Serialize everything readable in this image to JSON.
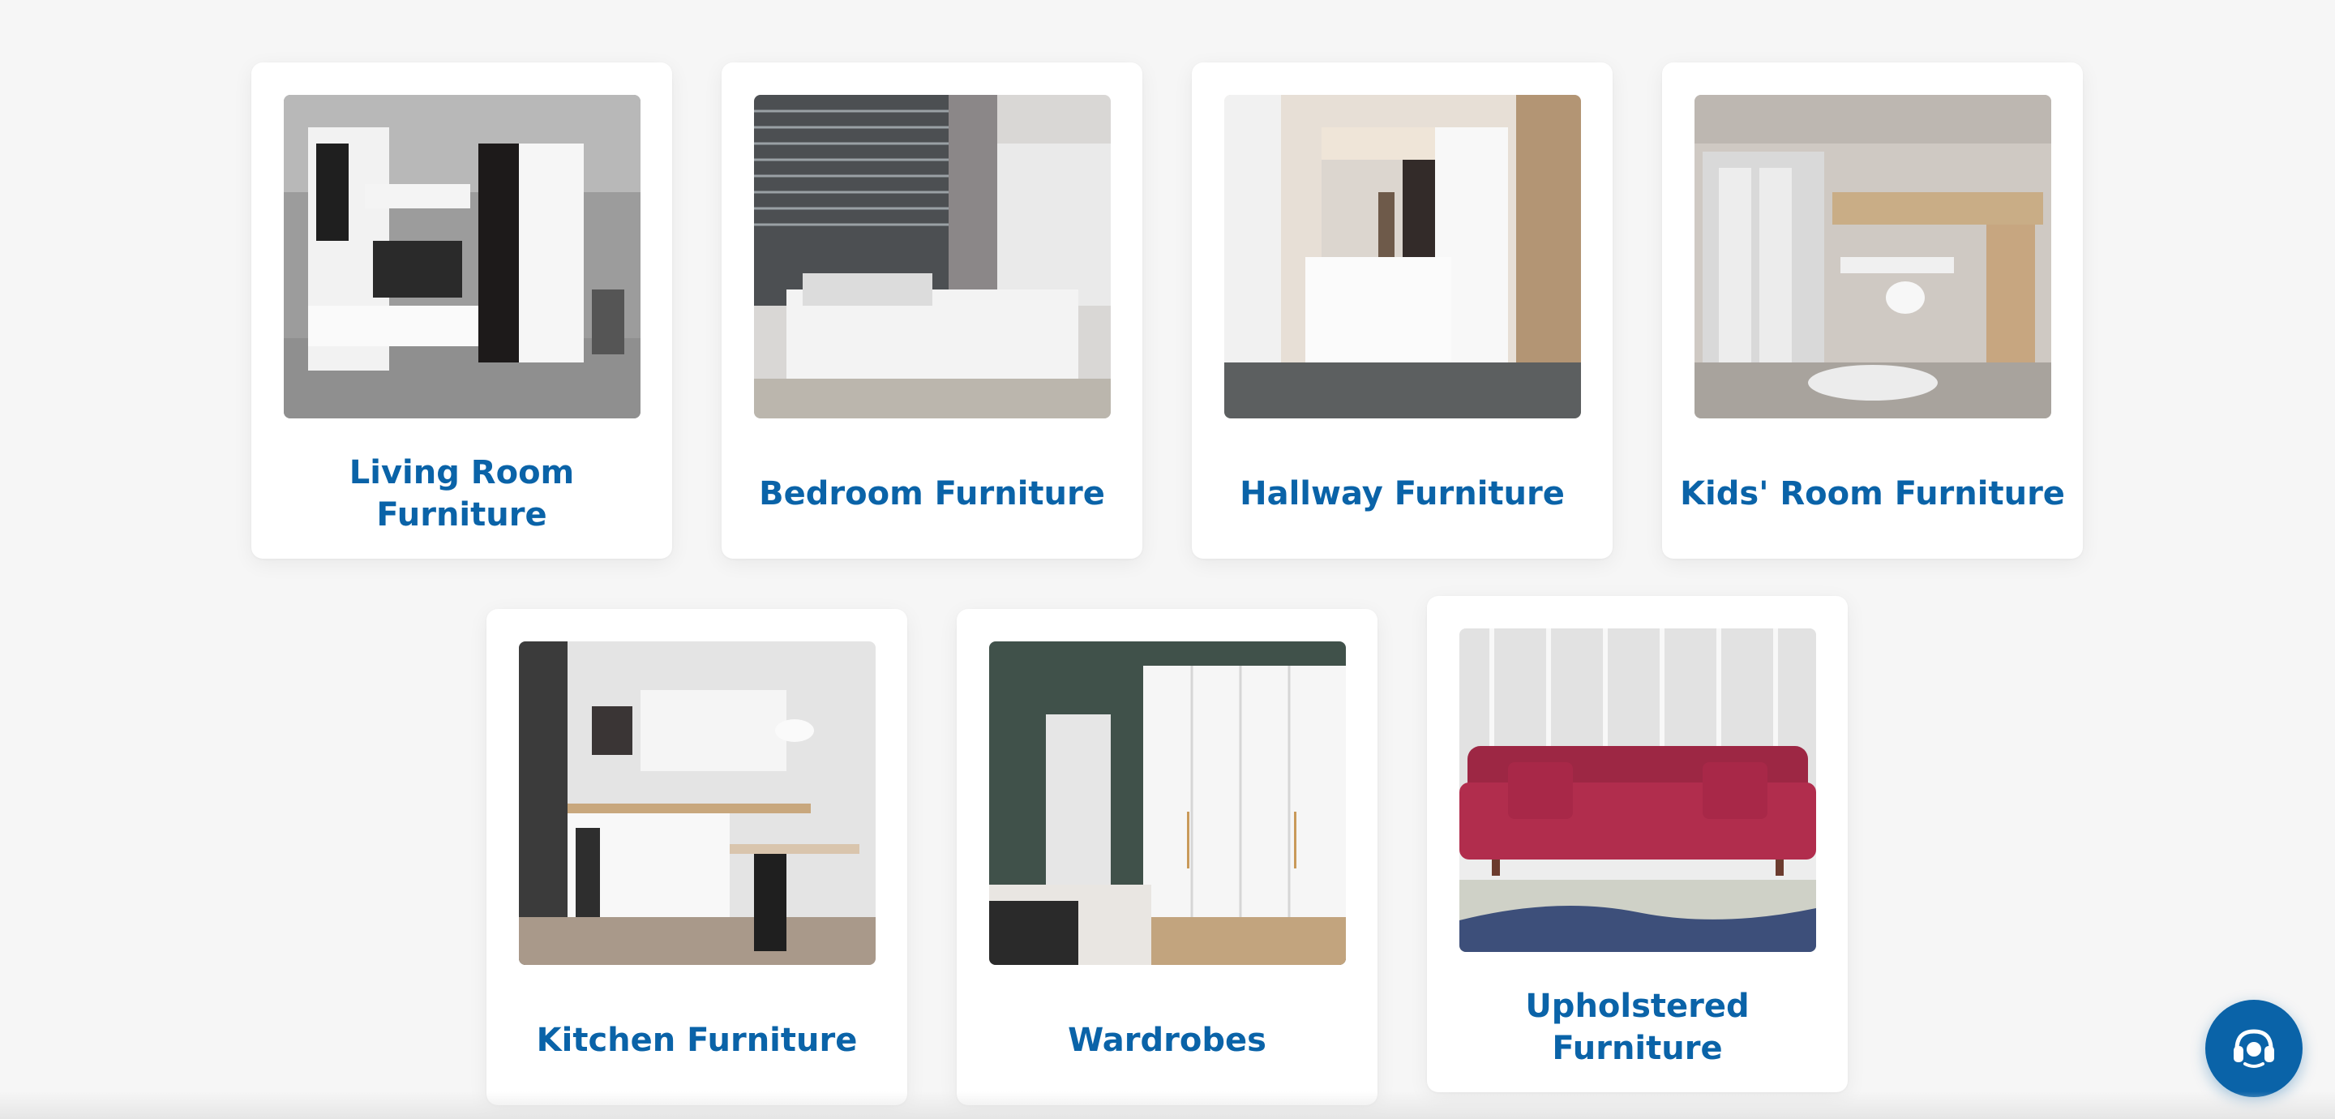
{
  "categories": [
    {
      "label": "Living Room Furniture",
      "image": "living-room-photo"
    },
    {
      "label": "Bedroom Furniture",
      "image": "bedroom-photo"
    },
    {
      "label": "Hallway Furniture",
      "image": "hallway-photo"
    },
    {
      "label": "Kids' Room Furniture",
      "image": "kids-room-photo"
    },
    {
      "label": "Kitchen Furniture",
      "image": "kitchen-photo"
    },
    {
      "label": "Wardrobes",
      "image": "wardrobe-photo"
    },
    {
      "label": "Upholstered Furniture",
      "image": "sofa-photo"
    }
  ],
  "support_button": {
    "icon": "headset-icon"
  },
  "colors": {
    "accent": "#0a63a8",
    "background": "#f6f6f6",
    "card": "#ffffff"
  }
}
